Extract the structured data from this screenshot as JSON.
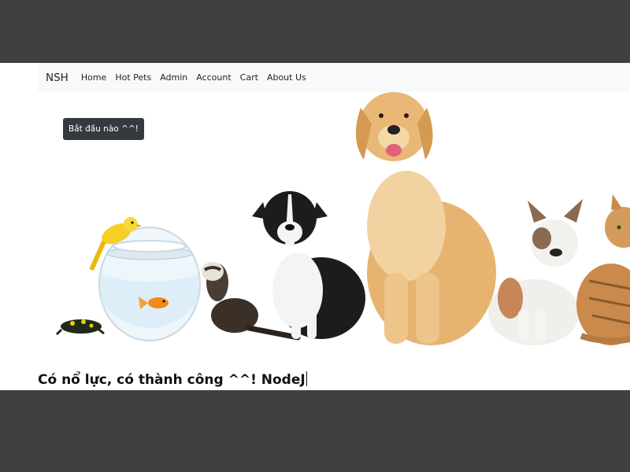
{
  "navbar": {
    "brand": "NSH",
    "links": [
      "Home",
      "Hot Pets",
      "Admin",
      "Account",
      "Cart",
      "About Us"
    ]
  },
  "hero": {
    "button_label": "Bắt đầu nào ^^!",
    "image_description_icon": "pets-banner-illustration"
  },
  "slogan": "Có nổ lực, có thành công ^^! NodeJ",
  "colors": {
    "outer_background": "#404040",
    "navbar_background": "#f8f9fa",
    "button_background": "#343a40"
  }
}
